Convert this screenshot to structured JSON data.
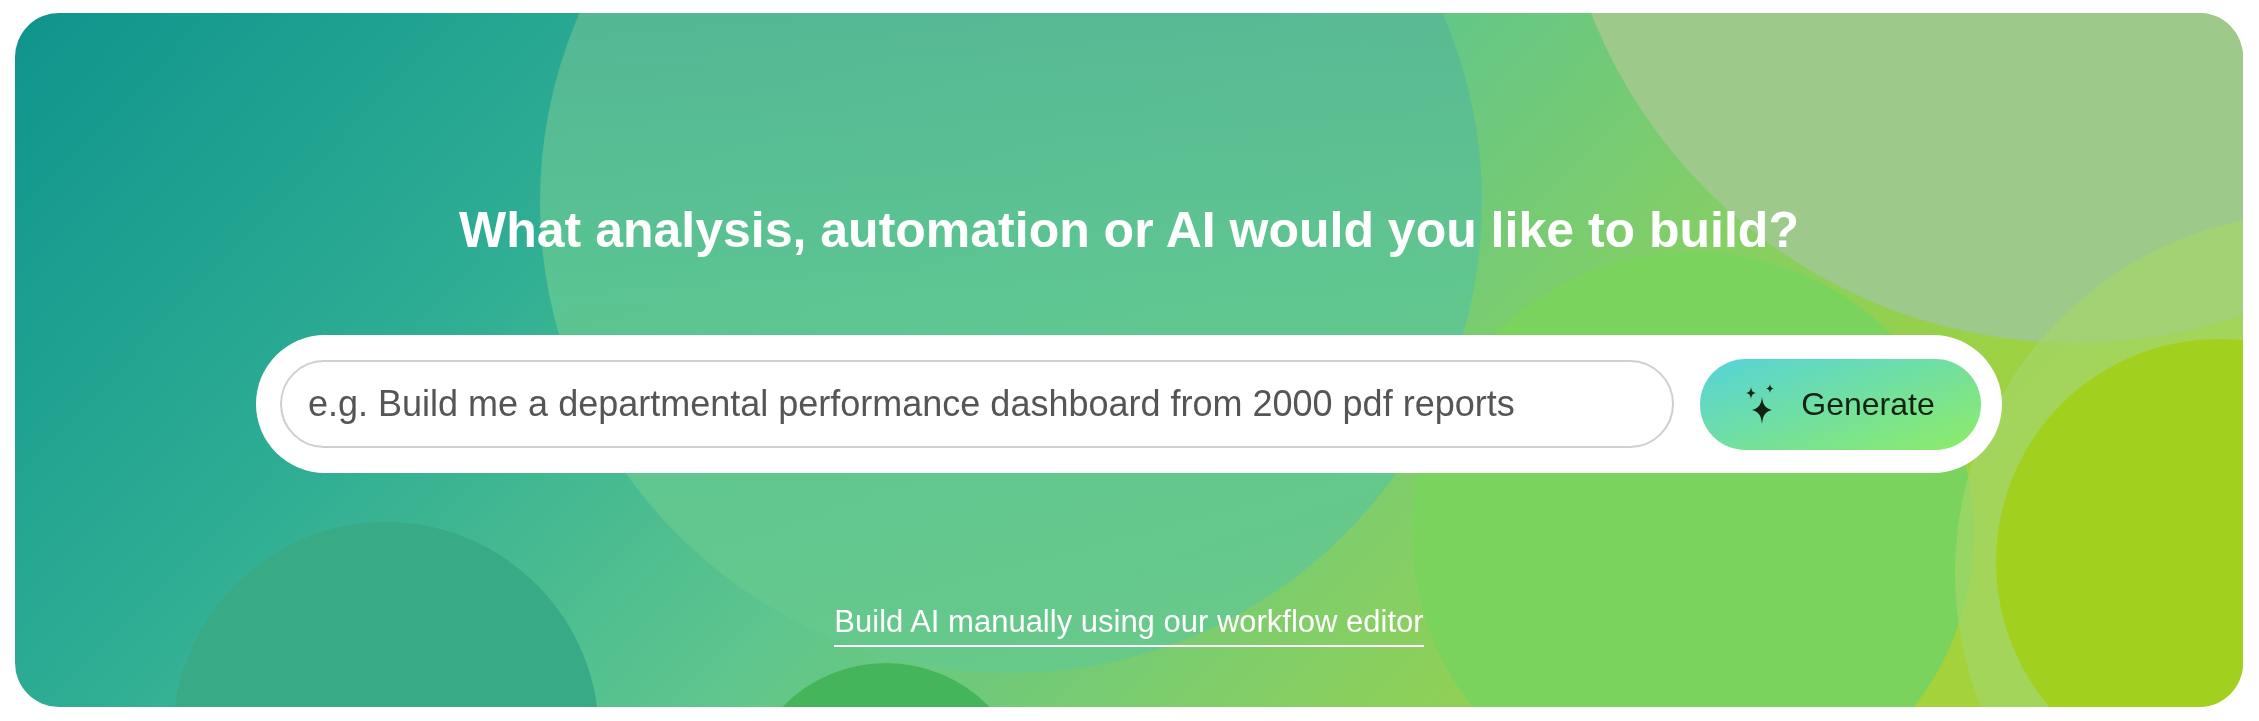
{
  "heading": "What analysis, automation or AI would you like to build?",
  "prompt": {
    "placeholder": "e.g. Build me a departmental performance dashboard from 2000 pdf reports"
  },
  "generate_button": {
    "label": "Generate"
  },
  "manual_link": {
    "label": "Build AI manually using our workflow editor"
  }
}
